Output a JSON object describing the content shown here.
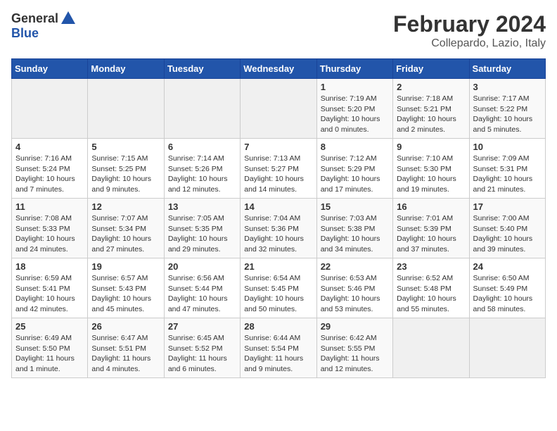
{
  "header": {
    "logo_general": "General",
    "logo_blue": "Blue",
    "title": "February 2024",
    "subtitle": "Collepardo, Lazio, Italy"
  },
  "weekdays": [
    "Sunday",
    "Monday",
    "Tuesday",
    "Wednesday",
    "Thursday",
    "Friday",
    "Saturday"
  ],
  "weeks": [
    [
      {
        "day": "",
        "info": ""
      },
      {
        "day": "",
        "info": ""
      },
      {
        "day": "",
        "info": ""
      },
      {
        "day": "",
        "info": ""
      },
      {
        "day": "1",
        "info": "Sunrise: 7:19 AM\nSunset: 5:20 PM\nDaylight: 10 hours\nand 0 minutes."
      },
      {
        "day": "2",
        "info": "Sunrise: 7:18 AM\nSunset: 5:21 PM\nDaylight: 10 hours\nand 2 minutes."
      },
      {
        "day": "3",
        "info": "Sunrise: 7:17 AM\nSunset: 5:22 PM\nDaylight: 10 hours\nand 5 minutes."
      }
    ],
    [
      {
        "day": "4",
        "info": "Sunrise: 7:16 AM\nSunset: 5:24 PM\nDaylight: 10 hours\nand 7 minutes."
      },
      {
        "day": "5",
        "info": "Sunrise: 7:15 AM\nSunset: 5:25 PM\nDaylight: 10 hours\nand 9 minutes."
      },
      {
        "day": "6",
        "info": "Sunrise: 7:14 AM\nSunset: 5:26 PM\nDaylight: 10 hours\nand 12 minutes."
      },
      {
        "day": "7",
        "info": "Sunrise: 7:13 AM\nSunset: 5:27 PM\nDaylight: 10 hours\nand 14 minutes."
      },
      {
        "day": "8",
        "info": "Sunrise: 7:12 AM\nSunset: 5:29 PM\nDaylight: 10 hours\nand 17 minutes."
      },
      {
        "day": "9",
        "info": "Sunrise: 7:10 AM\nSunset: 5:30 PM\nDaylight: 10 hours\nand 19 minutes."
      },
      {
        "day": "10",
        "info": "Sunrise: 7:09 AM\nSunset: 5:31 PM\nDaylight: 10 hours\nand 21 minutes."
      }
    ],
    [
      {
        "day": "11",
        "info": "Sunrise: 7:08 AM\nSunset: 5:33 PM\nDaylight: 10 hours\nand 24 minutes."
      },
      {
        "day": "12",
        "info": "Sunrise: 7:07 AM\nSunset: 5:34 PM\nDaylight: 10 hours\nand 27 minutes."
      },
      {
        "day": "13",
        "info": "Sunrise: 7:05 AM\nSunset: 5:35 PM\nDaylight: 10 hours\nand 29 minutes."
      },
      {
        "day": "14",
        "info": "Sunrise: 7:04 AM\nSunset: 5:36 PM\nDaylight: 10 hours\nand 32 minutes."
      },
      {
        "day": "15",
        "info": "Sunrise: 7:03 AM\nSunset: 5:38 PM\nDaylight: 10 hours\nand 34 minutes."
      },
      {
        "day": "16",
        "info": "Sunrise: 7:01 AM\nSunset: 5:39 PM\nDaylight: 10 hours\nand 37 minutes."
      },
      {
        "day": "17",
        "info": "Sunrise: 7:00 AM\nSunset: 5:40 PM\nDaylight: 10 hours\nand 39 minutes."
      }
    ],
    [
      {
        "day": "18",
        "info": "Sunrise: 6:59 AM\nSunset: 5:41 PM\nDaylight: 10 hours\nand 42 minutes."
      },
      {
        "day": "19",
        "info": "Sunrise: 6:57 AM\nSunset: 5:43 PM\nDaylight: 10 hours\nand 45 minutes."
      },
      {
        "day": "20",
        "info": "Sunrise: 6:56 AM\nSunset: 5:44 PM\nDaylight: 10 hours\nand 47 minutes."
      },
      {
        "day": "21",
        "info": "Sunrise: 6:54 AM\nSunset: 5:45 PM\nDaylight: 10 hours\nand 50 minutes."
      },
      {
        "day": "22",
        "info": "Sunrise: 6:53 AM\nSunset: 5:46 PM\nDaylight: 10 hours\nand 53 minutes."
      },
      {
        "day": "23",
        "info": "Sunrise: 6:52 AM\nSunset: 5:48 PM\nDaylight: 10 hours\nand 55 minutes."
      },
      {
        "day": "24",
        "info": "Sunrise: 6:50 AM\nSunset: 5:49 PM\nDaylight: 10 hours\nand 58 minutes."
      }
    ],
    [
      {
        "day": "25",
        "info": "Sunrise: 6:49 AM\nSunset: 5:50 PM\nDaylight: 11 hours\nand 1 minute."
      },
      {
        "day": "26",
        "info": "Sunrise: 6:47 AM\nSunset: 5:51 PM\nDaylight: 11 hours\nand 4 minutes."
      },
      {
        "day": "27",
        "info": "Sunrise: 6:45 AM\nSunset: 5:52 PM\nDaylight: 11 hours\nand 6 minutes."
      },
      {
        "day": "28",
        "info": "Sunrise: 6:44 AM\nSunset: 5:54 PM\nDaylight: 11 hours\nand 9 minutes."
      },
      {
        "day": "29",
        "info": "Sunrise: 6:42 AM\nSunset: 5:55 PM\nDaylight: 11 hours\nand 12 minutes."
      },
      {
        "day": "",
        "info": ""
      },
      {
        "day": "",
        "info": ""
      }
    ]
  ]
}
